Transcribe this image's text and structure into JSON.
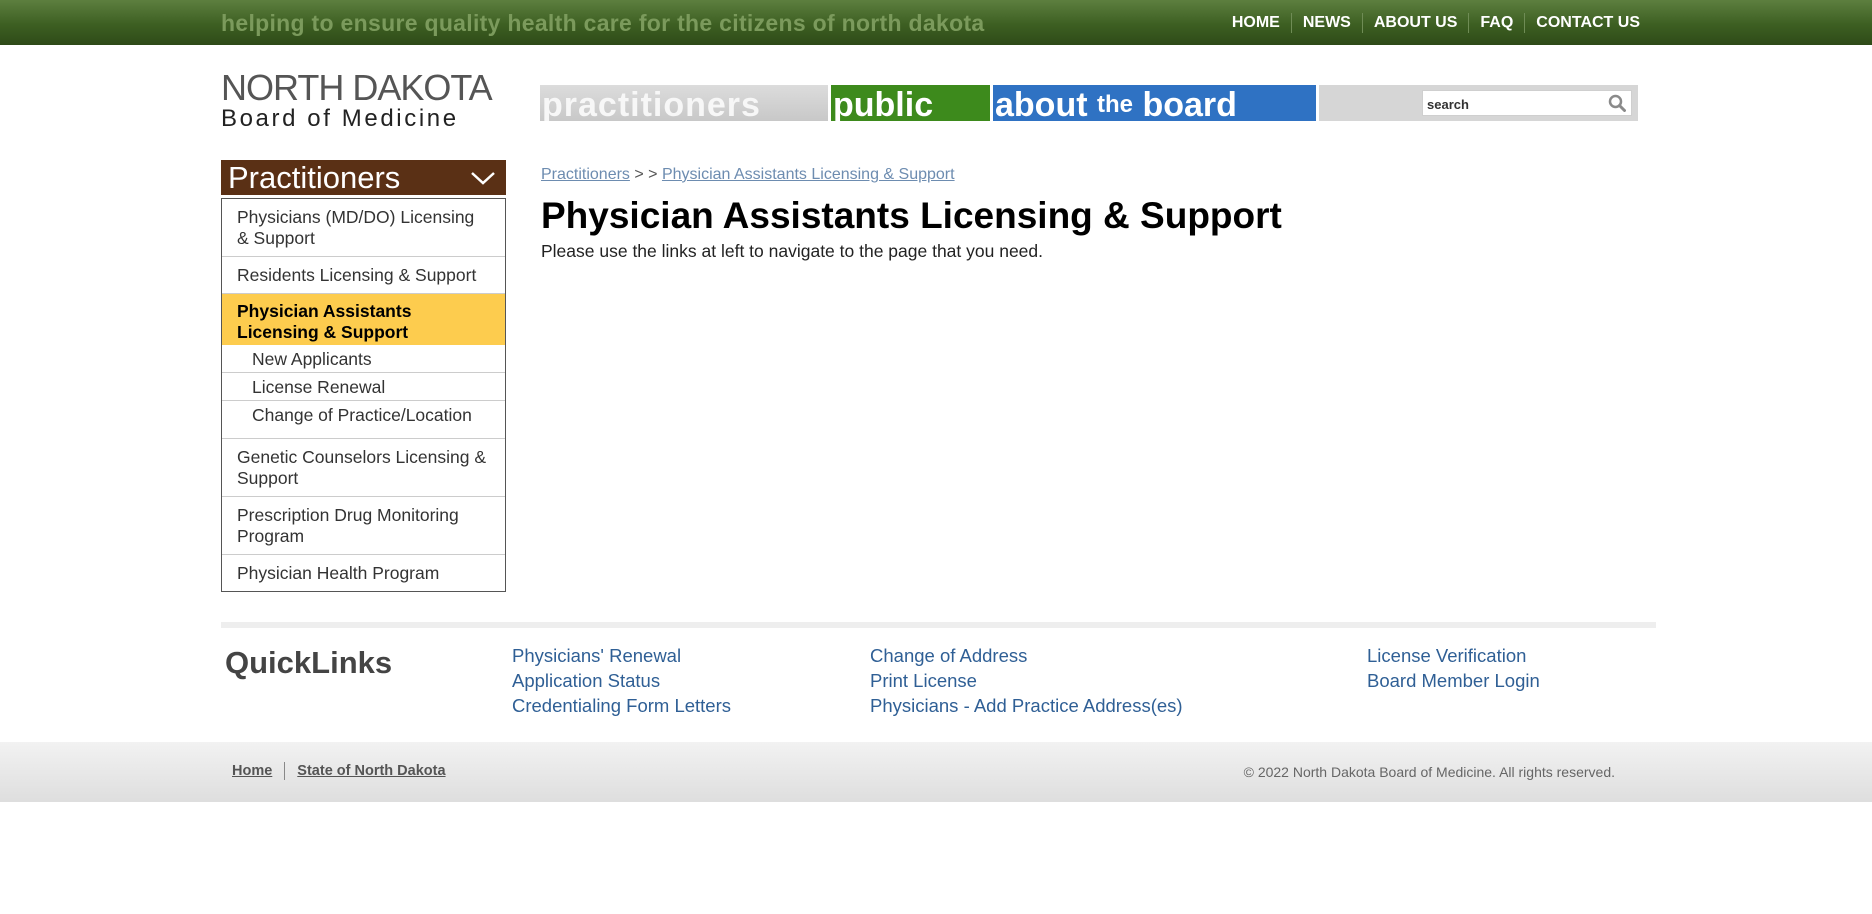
{
  "topbar": {
    "tagline": "helping to ensure quality health care for the citizens of north dakota",
    "nav": [
      "HOME",
      "NEWS",
      "ABOUT US",
      "FAQ",
      "CONTACT US"
    ],
    "background_color": "#3d5f22"
  },
  "logo": {
    "line1": "NORTH DAKOTA",
    "line2": "Board of Medicine"
  },
  "mainnav": {
    "practitioners": "practitioners",
    "public": "public",
    "about_big1": "about",
    "about_small": "the",
    "about_big2": "board",
    "search_placeholder": "search",
    "colors": {
      "practitioners": "#d0d0d0",
      "public": "#3d8a1c",
      "about": "#2f72c3"
    }
  },
  "sidebar": {
    "header": "Practitioners",
    "header_color": "#5a3015",
    "active_color": "#fdcc4e",
    "items": [
      "Physicians (MD/DO) Licensing & Support",
      "Residents Licensing & Support",
      "Physician Assistants Licensing & Support",
      "Genetic Counselors Licensing & Support",
      "Prescription Drug Monitoring Program",
      "Physician Health Program"
    ],
    "subitems": [
      "New Applicants",
      "License Renewal",
      "Change of Practice/Location"
    ]
  },
  "content": {
    "breadcrumb_1": "Practitioners",
    "breadcrumb_sep": "> >",
    "breadcrumb_2": "Physician Assistants Licensing & Support",
    "title": "Physician Assistants Licensing & Support",
    "intro": "Please use the links at left to navigate to the page that you need."
  },
  "quicklinks": {
    "title": "QuickLinks",
    "col1": [
      "Physicians' Renewal",
      "Application Status",
      "Credentialing Form Letters"
    ],
    "col2": [
      "Change of Address",
      "Print License",
      "Physicians - Add Practice Address(es)"
    ],
    "col3": [
      "License Verification",
      "Board Member Login"
    ]
  },
  "footer": {
    "links": [
      "Home",
      "State of North Dakota"
    ],
    "copyright": "© 2022 North Dakota Board of Medicine. All rights reserved."
  }
}
